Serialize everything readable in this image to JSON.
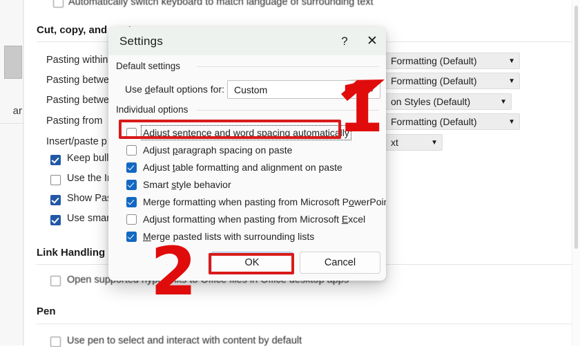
{
  "background_page": {
    "left_rail": {
      "partial_label": "ar"
    },
    "section_top_option": "Automatically switch keyboard to match language of surrounding text",
    "sections": [
      {
        "heading": "Cut, copy, and paste"
      },
      {
        "heading": "Link Handling"
      },
      {
        "heading": "Pen"
      }
    ],
    "paste_rows": [
      {
        "label": "Pasting within",
        "value": "Formatting (Default)"
      },
      {
        "label": "Pasting betwe",
        "value": "Formatting (Default)"
      },
      {
        "label": "Pasting betwe",
        "value": "on Styles (Default)"
      },
      {
        "label": "Pasting from ",
        "value": "Formatting (Default)"
      },
      {
        "label": "Insert/paste p",
        "value": "xt"
      }
    ],
    "checkbox_rows": [
      {
        "label": "Keep bulle",
        "checked": true
      },
      {
        "label": "Use the In",
        "checked": false
      },
      {
        "label": "Show Past",
        "checked": true
      },
      {
        "label": "Use smart",
        "checked": true
      }
    ],
    "link_handling_option": "Open supported hyperlinks to Office files in Office desktop apps",
    "link_handling_checked": false,
    "pen_option": "Use pen to select and interact with content by default",
    "pen_checked": false
  },
  "dialog": {
    "title": "Settings",
    "help_icon": "?",
    "close_icon": "✕",
    "group_default": "Default settings",
    "default_field_label": "Use default options for:",
    "default_field_value": "Custom",
    "group_individual": "Individual options",
    "options": [
      {
        "label": "Adjust sentence and word spacing automatically",
        "checked": false,
        "underline_index": 21,
        "focused": true
      },
      {
        "label": "Adjust paragraph spacing on paste",
        "checked": false,
        "underline_index": 7
      },
      {
        "label": "Adjust table formatting and alignment on paste",
        "checked": true,
        "underline_index": 7
      },
      {
        "label": "Smart style behavior",
        "checked": true,
        "underline_index": 6
      },
      {
        "label": "Merge formatting when pasting from Microsoft PowerPoint",
        "checked": true,
        "underline_index": 44
      },
      {
        "label": "Adjust formatting when pasting from Microsoft Excel",
        "checked": false,
        "underline_index": 44
      },
      {
        "label": "Merge pasted lists with surrounding lists",
        "checked": true,
        "underline_index": 0
      }
    ],
    "ok_button": "OK",
    "cancel_button": "Cancel"
  },
  "annotations": {
    "step_one": "1",
    "step_two": "2",
    "highlight_color": "#d91a1a"
  },
  "colors": {
    "accent_checkbox": "#1268c3",
    "bg_checkbox": "#2258a5",
    "dialog_bg": "#fafafa",
    "titlebar_bg": "#eef2ef",
    "annotation_red": "#e00c0c"
  }
}
